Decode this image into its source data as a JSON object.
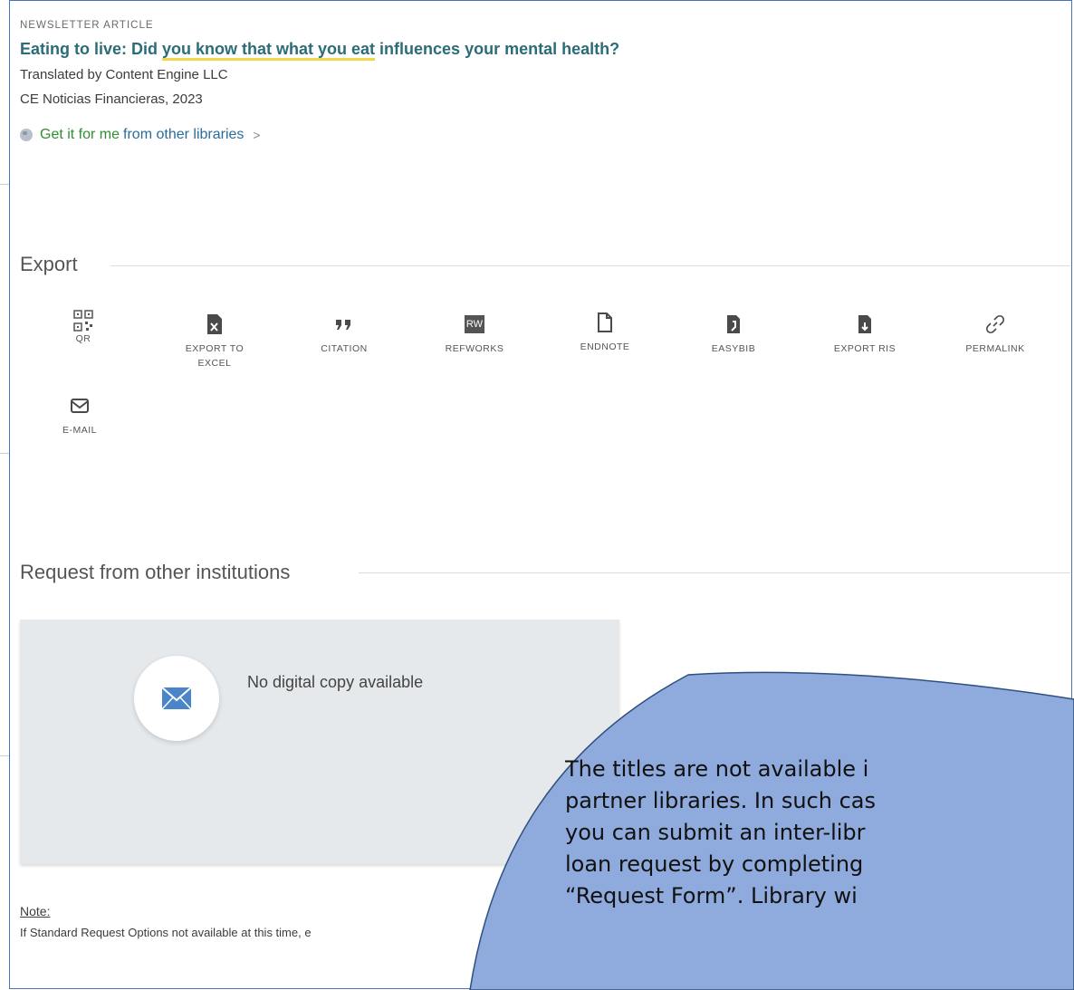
{
  "record": {
    "type_label": "NEWSLETTER ARTICLE",
    "title_part1": "Eating to live: Did ",
    "title_highlight": "you know that what you eat",
    "title_part2": " influences your mental health?",
    "translator": "Translated by Content Engine LLC",
    "source": "CE Noticias Financieras, 2023",
    "getit_label": "Get it for me",
    "getit_link": "from other libraries",
    "getit_chevron": ">"
  },
  "export": {
    "heading": "Export",
    "items": [
      {
        "label": "QR",
        "icon": "qr-code-icon"
      },
      {
        "label": "EXPORT TO EXCEL",
        "icon": "excel-icon"
      },
      {
        "label": "CITATION",
        "icon": "quote-icon"
      },
      {
        "label": "REFWORKS",
        "icon": "refworks-icon",
        "badge": "RW"
      },
      {
        "label": "ENDNOTE",
        "icon": "document-icon"
      },
      {
        "label": "EASYBIB",
        "icon": "easybib-icon"
      },
      {
        "label": "EXPORT RIS",
        "icon": "ris-icon"
      },
      {
        "label": "PERMALINK",
        "icon": "link-icon"
      },
      {
        "label": "E-MAIL",
        "icon": "mail-icon"
      }
    ]
  },
  "request": {
    "heading": "Request from other institutions",
    "card_text": "No digital copy available",
    "note_label": "Note:",
    "note_text": "If Standard Request Options not available at this time, e"
  },
  "callout": {
    "lines": [
      "The titles are not available i",
      "partner libraries. In such cas",
      "you can submit an inter-libr",
      "loan request by completing",
      "“Request Form”.  Library wi"
    ],
    "fill": "#8faadc",
    "stroke": "#2f4f7f"
  }
}
